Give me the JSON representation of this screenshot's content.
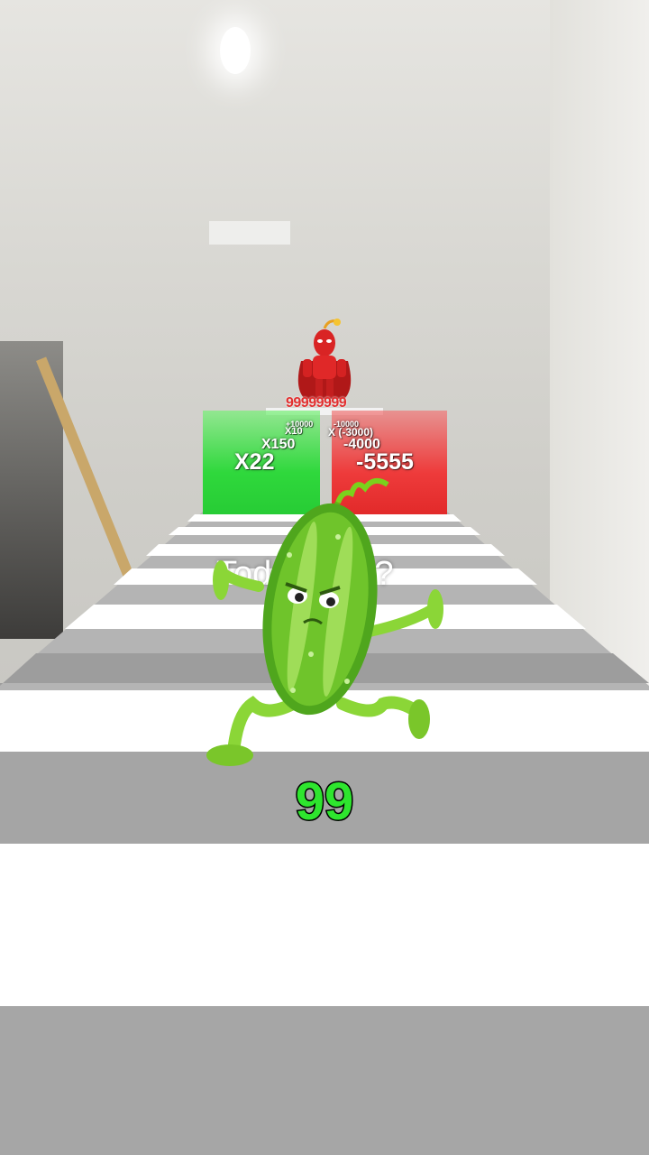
{
  "boss": {
    "score": "99999999",
    "icon": "chili-hero-icon"
  },
  "gates": {
    "green": [
      "X22",
      "X150",
      "X10",
      "+10000"
    ],
    "red": [
      "-5555",
      "-4000",
      "X (-3000)",
      "-10000"
    ]
  },
  "caption": "Todo mal??",
  "player": {
    "icon": "cucumber-character-icon",
    "score": "99"
  },
  "colors": {
    "score": "#2ee52e",
    "green_gate": "#2fd83c",
    "red_gate": "#ee3b3b",
    "boss": "#e23030"
  }
}
